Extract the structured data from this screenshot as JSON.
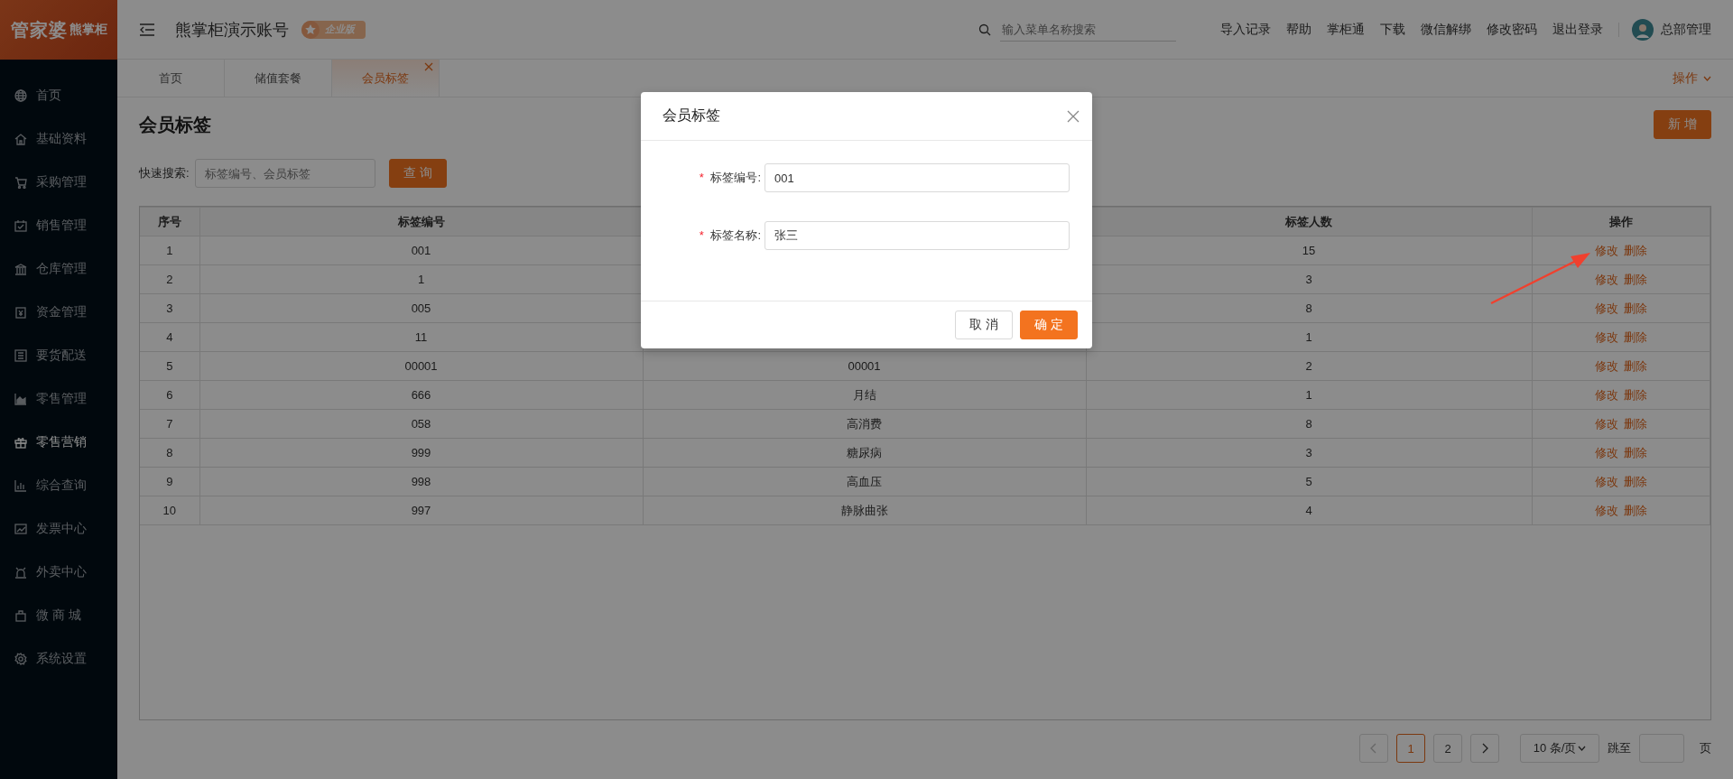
{
  "logo": {
    "brand": "管家婆",
    "product": "熊掌柜"
  },
  "header": {
    "title": "熊掌柜演示账号",
    "edition": "企业版",
    "search": {
      "placeholder": "输入菜单名称搜索"
    },
    "links": [
      "导入记录",
      "帮助",
      "掌柜通",
      "下载",
      "微信解绑",
      "修改密码",
      "退出登录"
    ],
    "user": "总部管理"
  },
  "sidebar": {
    "items": [
      {
        "label": "首页",
        "selected": false
      },
      {
        "label": "基础资料",
        "selected": false
      },
      {
        "label": "采购管理",
        "selected": false
      },
      {
        "label": "销售管理",
        "selected": false
      },
      {
        "label": "仓库管理",
        "selected": false
      },
      {
        "label": "资金管理",
        "selected": false
      },
      {
        "label": "要货配送",
        "selected": false
      },
      {
        "label": "零售管理",
        "selected": false
      },
      {
        "label": "零售营销",
        "selected": true
      },
      {
        "label": "综合查询",
        "selected": false
      },
      {
        "label": "发票中心",
        "selected": false
      },
      {
        "label": "外卖中心",
        "selected": false
      },
      {
        "label": "微 商 城",
        "selected": false
      },
      {
        "label": "系统设置",
        "selected": false
      }
    ]
  },
  "tabs": [
    {
      "label": "首页",
      "selected": false,
      "closable": false
    },
    {
      "label": "储值套餐",
      "selected": false,
      "closable": false
    },
    {
      "label": "会员标签",
      "selected": true,
      "closable": true
    }
  ],
  "tab_menu": "操作",
  "page": {
    "title": "会员标签",
    "add_button": "新 增",
    "search_label": "快速搜索:",
    "search_placeholder": "标签编号、会员标签",
    "query_button": "查 询"
  },
  "table": {
    "columns": [
      "序号",
      "标签编号",
      null,
      "标签人数",
      "操作"
    ],
    "rows": [
      {
        "cells": [
          "1",
          "001",
          null,
          "15"
        ],
        "actions": [
          "修改",
          "删除"
        ]
      },
      {
        "cells": [
          "2",
          "1",
          null,
          "3"
        ],
        "actions": [
          "修改",
          "删除"
        ]
      },
      {
        "cells": [
          "3",
          "005",
          null,
          "8"
        ],
        "actions": [
          "修改",
          "删除"
        ]
      },
      {
        "cells": [
          "4",
          "11",
          null,
          "1"
        ],
        "actions": [
          "修改",
          "删除"
        ]
      },
      {
        "cells": [
          "5",
          "00001",
          "00001",
          "2"
        ],
        "actions": [
          "修改",
          "删除"
        ]
      },
      {
        "cells": [
          "6",
          "666",
          "月结",
          "1"
        ],
        "actions": [
          "修改",
          "删除"
        ]
      },
      {
        "cells": [
          "7",
          "058",
          "高消费",
          "8"
        ],
        "actions": [
          "修改",
          "删除"
        ]
      },
      {
        "cells": [
          "8",
          "999",
          "糖尿病",
          "3"
        ],
        "actions": [
          "修改",
          "删除"
        ]
      },
      {
        "cells": [
          "9",
          "998",
          "高血压",
          "5"
        ],
        "actions": [
          "修改",
          "删除"
        ]
      },
      {
        "cells": [
          "10",
          "997",
          "静脉曲张",
          "4"
        ],
        "actions": [
          "修改",
          "删除"
        ]
      }
    ]
  },
  "pagination": {
    "pages": [
      {
        "label": "1",
        "selected": true
      },
      {
        "label": "2",
        "selected": false
      }
    ],
    "page_size": "10 条/页",
    "goto_label": "跳至",
    "page_suffix": "页"
  },
  "modal": {
    "title": "会员标签",
    "fields": [
      {
        "label": "标签编号:",
        "required_mark": "*",
        "value": "001"
      },
      {
        "label": "标签名称:",
        "required_mark": "*",
        "value": "张三"
      }
    ],
    "buttons": [
      {
        "label": "取 消",
        "kind": "default"
      },
      {
        "label": "确 定",
        "kind": "primary"
      }
    ]
  }
}
